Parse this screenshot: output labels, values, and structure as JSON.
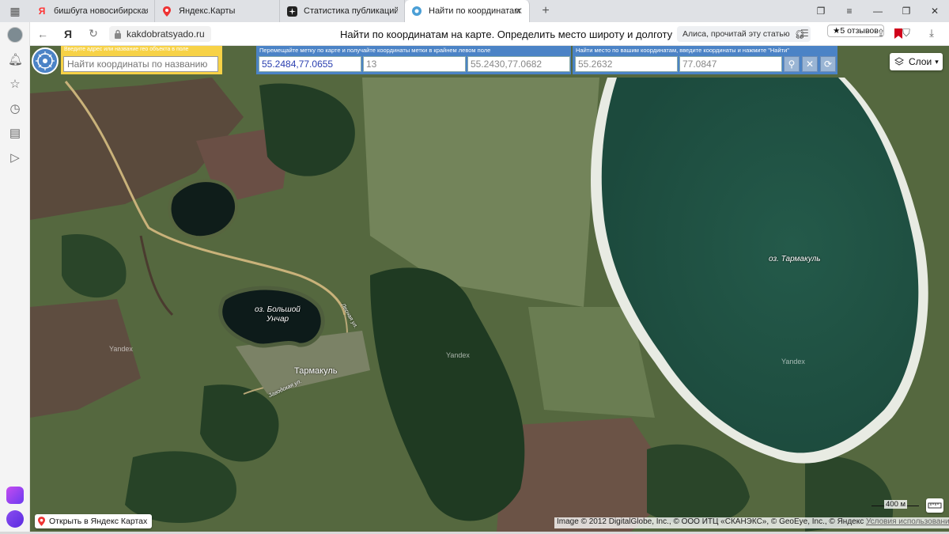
{
  "tabs": [
    {
      "title": "бишбуга новосибирская с",
      "icon": "yandex-y-icon",
      "active": false
    },
    {
      "title": "Яндекс.Карты",
      "icon": "map-pin-icon",
      "active": false
    },
    {
      "title": "Статистика публикаций | ",
      "icon": "zen-icon",
      "active": false
    },
    {
      "title": "Найти по координатам",
      "icon": "site-favicon-icon",
      "active": true
    }
  ],
  "addressbar": {
    "brand_glyph": "Я",
    "url": "kakdobratsyado.ru",
    "page_title": "Найти по координатам на карте. Определить место широту и долготу",
    "alice_read": "Алиса, прочитай эту статью",
    "reviews": "★5 отзывов"
  },
  "panels": {
    "search": {
      "label": "Введите адрес или название гео объекта в поле",
      "placeholder": "Найти координаты по названию"
    },
    "move": {
      "label": "Перемещайте метку по карте и получайте координаты метки в крайнем левом поле",
      "coords": "55.2484,77.0655",
      "zoom": "13",
      "corner": "55.2430,77.0682"
    },
    "find": {
      "label": "Найти место по вашим координатам, введите координаты и нажмите \"Найти\"",
      "lat": "55.2632",
      "lon": "77.0847"
    }
  },
  "map": {
    "layers_label": "Слои",
    "labels": {
      "lake_bolshoy_line1": "оз. Большой",
      "lake_bolshoy_line2": "Унчар",
      "village": "Тармакуль",
      "lake_tarmakul": "оз. Тармакуль",
      "street1": "Лесная ул.",
      "street2": "Заводская ул.",
      "yandex1": "Yandex",
      "yandex2": "Yandex",
      "yandex3": "Yandex"
    },
    "open_in_yandex": "Открыть в Яндекс Картах",
    "copyright": "Image © 2012 DigitalGlobe, Inc., © ООО ИТЦ «СКАНЭКС», © GeoEye, Inc., © Яндекс",
    "terms_link": "Условия использования",
    "scale": "400 м"
  },
  "colors": {
    "panel_blue": "#4b83c6",
    "panel_yellow": "#f7d247",
    "lake": "#1f4a3f",
    "bookmark_red": "#d0021b"
  }
}
